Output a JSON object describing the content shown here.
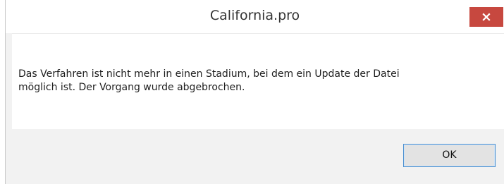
{
  "window": {
    "title": "California.pro",
    "close_icon": "close-icon",
    "close_glyph": "×"
  },
  "dialog": {
    "message": "Das Verfahren ist nicht mehr in einen Stadium, bei dem ein Update der Datei\nmöglich ist. Der Vorgang wurde abgebrochen.",
    "ok_label": "OK"
  },
  "colors": {
    "close_button": "#c7483f",
    "ok_border": "#4a8fd0",
    "footer_bg": "#f2f2f2"
  }
}
